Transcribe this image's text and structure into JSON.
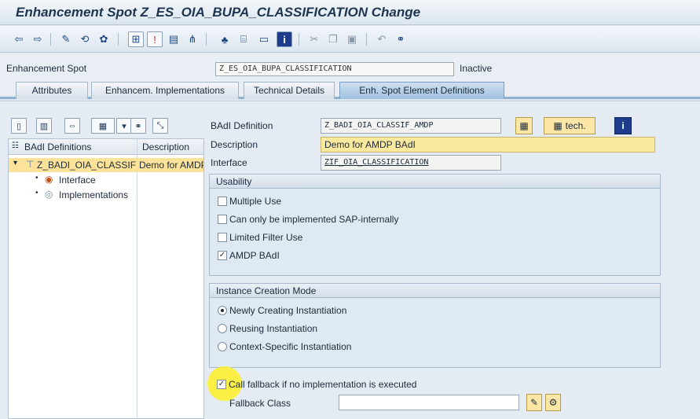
{
  "window": {
    "title": "Enhancement Spot Z_ES_OIA_BUPA_CLASSIFICATION Change"
  },
  "toolbar": {
    "icons": [
      "back-arrow-icon",
      "forward-arrow-icon",
      "other-object-icon",
      "display-change-icon",
      "activate-icon",
      "where-used-icon",
      "check-icon",
      "info-icon",
      "display-object-list-icon",
      "hierarchy-icon",
      "navigation-window-icon",
      "frame-icon",
      "info-i-icon",
      "cut-icon",
      "copy-icon",
      "paste-icon",
      "undo-icon",
      "find-icon"
    ]
  },
  "header": {
    "spot_label": "Enhancement Spot",
    "spot_value": "Z_ES_OIA_BUPA_CLASSIFICATION",
    "status": "Inactive"
  },
  "tabs": [
    {
      "label": "Attributes",
      "active": false
    },
    {
      "label": "Enhancem. Implementations",
      "active": false
    },
    {
      "label": "Technical Details",
      "active": false
    },
    {
      "label": "Enh. Spot Element Definitions",
      "active": true
    }
  ],
  "tree": {
    "columns": [
      "BAdI Definitions",
      "Description"
    ],
    "rows": [
      {
        "name": "Z_BADI_OIA_CLASSIF_AMDP",
        "description": "Demo for AMDP BAdI",
        "selected": true
      },
      {
        "name": "Interface",
        "description": ""
      },
      {
        "name": "Implementations",
        "description": ""
      }
    ]
  },
  "detail": {
    "badi_label": "BAdI Definition",
    "badi_value": "Z_BADI_OIA_CLASSIF_AMDP",
    "tech_button": "tech.",
    "description_label": "Description",
    "description_value": "Demo for AMDP BAdI",
    "interface_label": "Interface",
    "interface_value": "ZIF_OIA_CLASSIFICATION"
  },
  "usability": {
    "title": "Usability",
    "options": [
      {
        "label": "Multiple Use",
        "checked": false
      },
      {
        "label": "Can only be implemented SAP-internally",
        "checked": false
      },
      {
        "label": "Limited Filter Use",
        "checked": false
      },
      {
        "label": "AMDP BAdI",
        "checked": true
      }
    ]
  },
  "instance_mode": {
    "title": "Instance Creation Mode",
    "options": [
      {
        "label": "Newly Creating Instantiation",
        "selected": true
      },
      {
        "label": "Reusing Instantiation",
        "selected": false
      },
      {
        "label": "Context-Specific Instantiation",
        "selected": false
      }
    ]
  },
  "fallback": {
    "call_label": "Call fallback if no implementation is executed",
    "call_checked": true,
    "class_label": "Fallback Class",
    "class_value": ""
  }
}
